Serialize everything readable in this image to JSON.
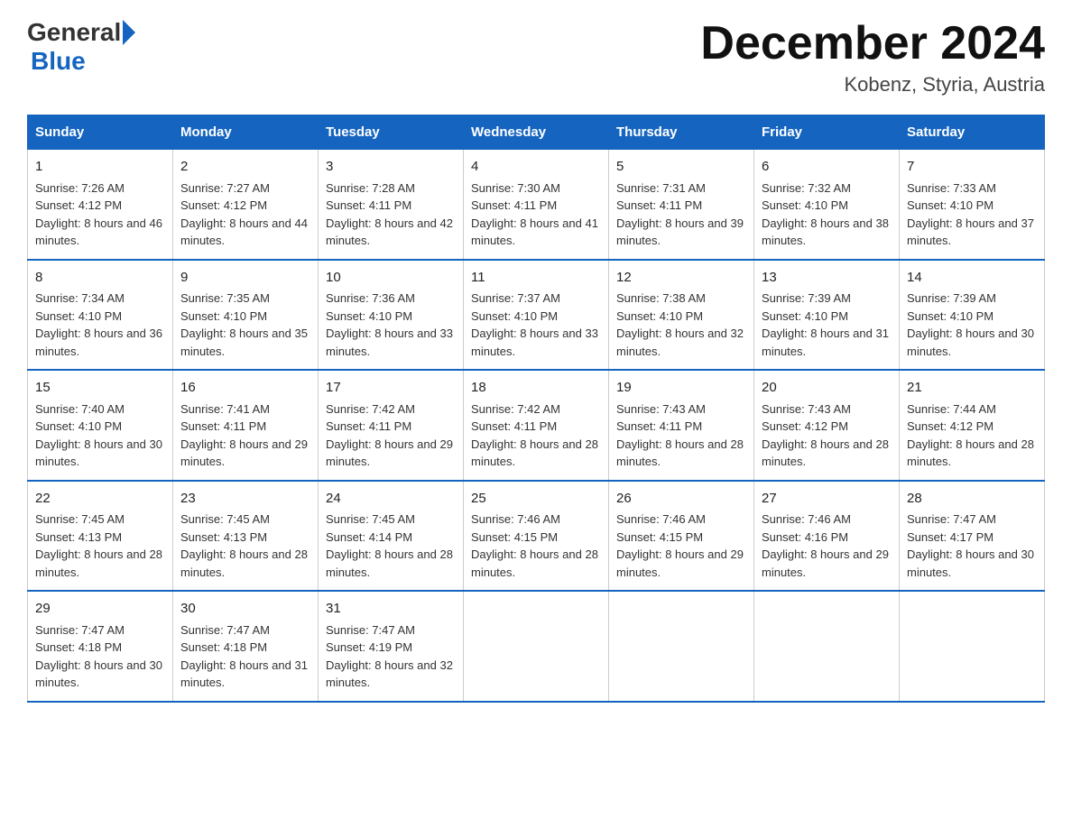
{
  "header": {
    "logo_general": "General",
    "logo_blue": "Blue",
    "title": "December 2024",
    "location": "Kobenz, Styria, Austria"
  },
  "days_of_week": [
    "Sunday",
    "Monday",
    "Tuesday",
    "Wednesday",
    "Thursday",
    "Friday",
    "Saturday"
  ],
  "weeks": [
    [
      {
        "day": "1",
        "sunrise": "7:26 AM",
        "sunset": "4:12 PM",
        "daylight": "8 hours and 46 minutes."
      },
      {
        "day": "2",
        "sunrise": "7:27 AM",
        "sunset": "4:12 PM",
        "daylight": "8 hours and 44 minutes."
      },
      {
        "day": "3",
        "sunrise": "7:28 AM",
        "sunset": "4:11 PM",
        "daylight": "8 hours and 42 minutes."
      },
      {
        "day": "4",
        "sunrise": "7:30 AM",
        "sunset": "4:11 PM",
        "daylight": "8 hours and 41 minutes."
      },
      {
        "day": "5",
        "sunrise": "7:31 AM",
        "sunset": "4:11 PM",
        "daylight": "8 hours and 39 minutes."
      },
      {
        "day": "6",
        "sunrise": "7:32 AM",
        "sunset": "4:10 PM",
        "daylight": "8 hours and 38 minutes."
      },
      {
        "day": "7",
        "sunrise": "7:33 AM",
        "sunset": "4:10 PM",
        "daylight": "8 hours and 37 minutes."
      }
    ],
    [
      {
        "day": "8",
        "sunrise": "7:34 AM",
        "sunset": "4:10 PM",
        "daylight": "8 hours and 36 minutes."
      },
      {
        "day": "9",
        "sunrise": "7:35 AM",
        "sunset": "4:10 PM",
        "daylight": "8 hours and 35 minutes."
      },
      {
        "day": "10",
        "sunrise": "7:36 AM",
        "sunset": "4:10 PM",
        "daylight": "8 hours and 33 minutes."
      },
      {
        "day": "11",
        "sunrise": "7:37 AM",
        "sunset": "4:10 PM",
        "daylight": "8 hours and 33 minutes."
      },
      {
        "day": "12",
        "sunrise": "7:38 AM",
        "sunset": "4:10 PM",
        "daylight": "8 hours and 32 minutes."
      },
      {
        "day": "13",
        "sunrise": "7:39 AM",
        "sunset": "4:10 PM",
        "daylight": "8 hours and 31 minutes."
      },
      {
        "day": "14",
        "sunrise": "7:39 AM",
        "sunset": "4:10 PM",
        "daylight": "8 hours and 30 minutes."
      }
    ],
    [
      {
        "day": "15",
        "sunrise": "7:40 AM",
        "sunset": "4:10 PM",
        "daylight": "8 hours and 30 minutes."
      },
      {
        "day": "16",
        "sunrise": "7:41 AM",
        "sunset": "4:11 PM",
        "daylight": "8 hours and 29 minutes."
      },
      {
        "day": "17",
        "sunrise": "7:42 AM",
        "sunset": "4:11 PM",
        "daylight": "8 hours and 29 minutes."
      },
      {
        "day": "18",
        "sunrise": "7:42 AM",
        "sunset": "4:11 PM",
        "daylight": "8 hours and 28 minutes."
      },
      {
        "day": "19",
        "sunrise": "7:43 AM",
        "sunset": "4:11 PM",
        "daylight": "8 hours and 28 minutes."
      },
      {
        "day": "20",
        "sunrise": "7:43 AM",
        "sunset": "4:12 PM",
        "daylight": "8 hours and 28 minutes."
      },
      {
        "day": "21",
        "sunrise": "7:44 AM",
        "sunset": "4:12 PM",
        "daylight": "8 hours and 28 minutes."
      }
    ],
    [
      {
        "day": "22",
        "sunrise": "7:45 AM",
        "sunset": "4:13 PM",
        "daylight": "8 hours and 28 minutes."
      },
      {
        "day": "23",
        "sunrise": "7:45 AM",
        "sunset": "4:13 PM",
        "daylight": "8 hours and 28 minutes."
      },
      {
        "day": "24",
        "sunrise": "7:45 AM",
        "sunset": "4:14 PM",
        "daylight": "8 hours and 28 minutes."
      },
      {
        "day": "25",
        "sunrise": "7:46 AM",
        "sunset": "4:15 PM",
        "daylight": "8 hours and 28 minutes."
      },
      {
        "day": "26",
        "sunrise": "7:46 AM",
        "sunset": "4:15 PM",
        "daylight": "8 hours and 29 minutes."
      },
      {
        "day": "27",
        "sunrise": "7:46 AM",
        "sunset": "4:16 PM",
        "daylight": "8 hours and 29 minutes."
      },
      {
        "day": "28",
        "sunrise": "7:47 AM",
        "sunset": "4:17 PM",
        "daylight": "8 hours and 30 minutes."
      }
    ],
    [
      {
        "day": "29",
        "sunrise": "7:47 AM",
        "sunset": "4:18 PM",
        "daylight": "8 hours and 30 minutes."
      },
      {
        "day": "30",
        "sunrise": "7:47 AM",
        "sunset": "4:18 PM",
        "daylight": "8 hours and 31 minutes."
      },
      {
        "day": "31",
        "sunrise": "7:47 AM",
        "sunset": "4:19 PM",
        "daylight": "8 hours and 32 minutes."
      },
      null,
      null,
      null,
      null
    ]
  ]
}
